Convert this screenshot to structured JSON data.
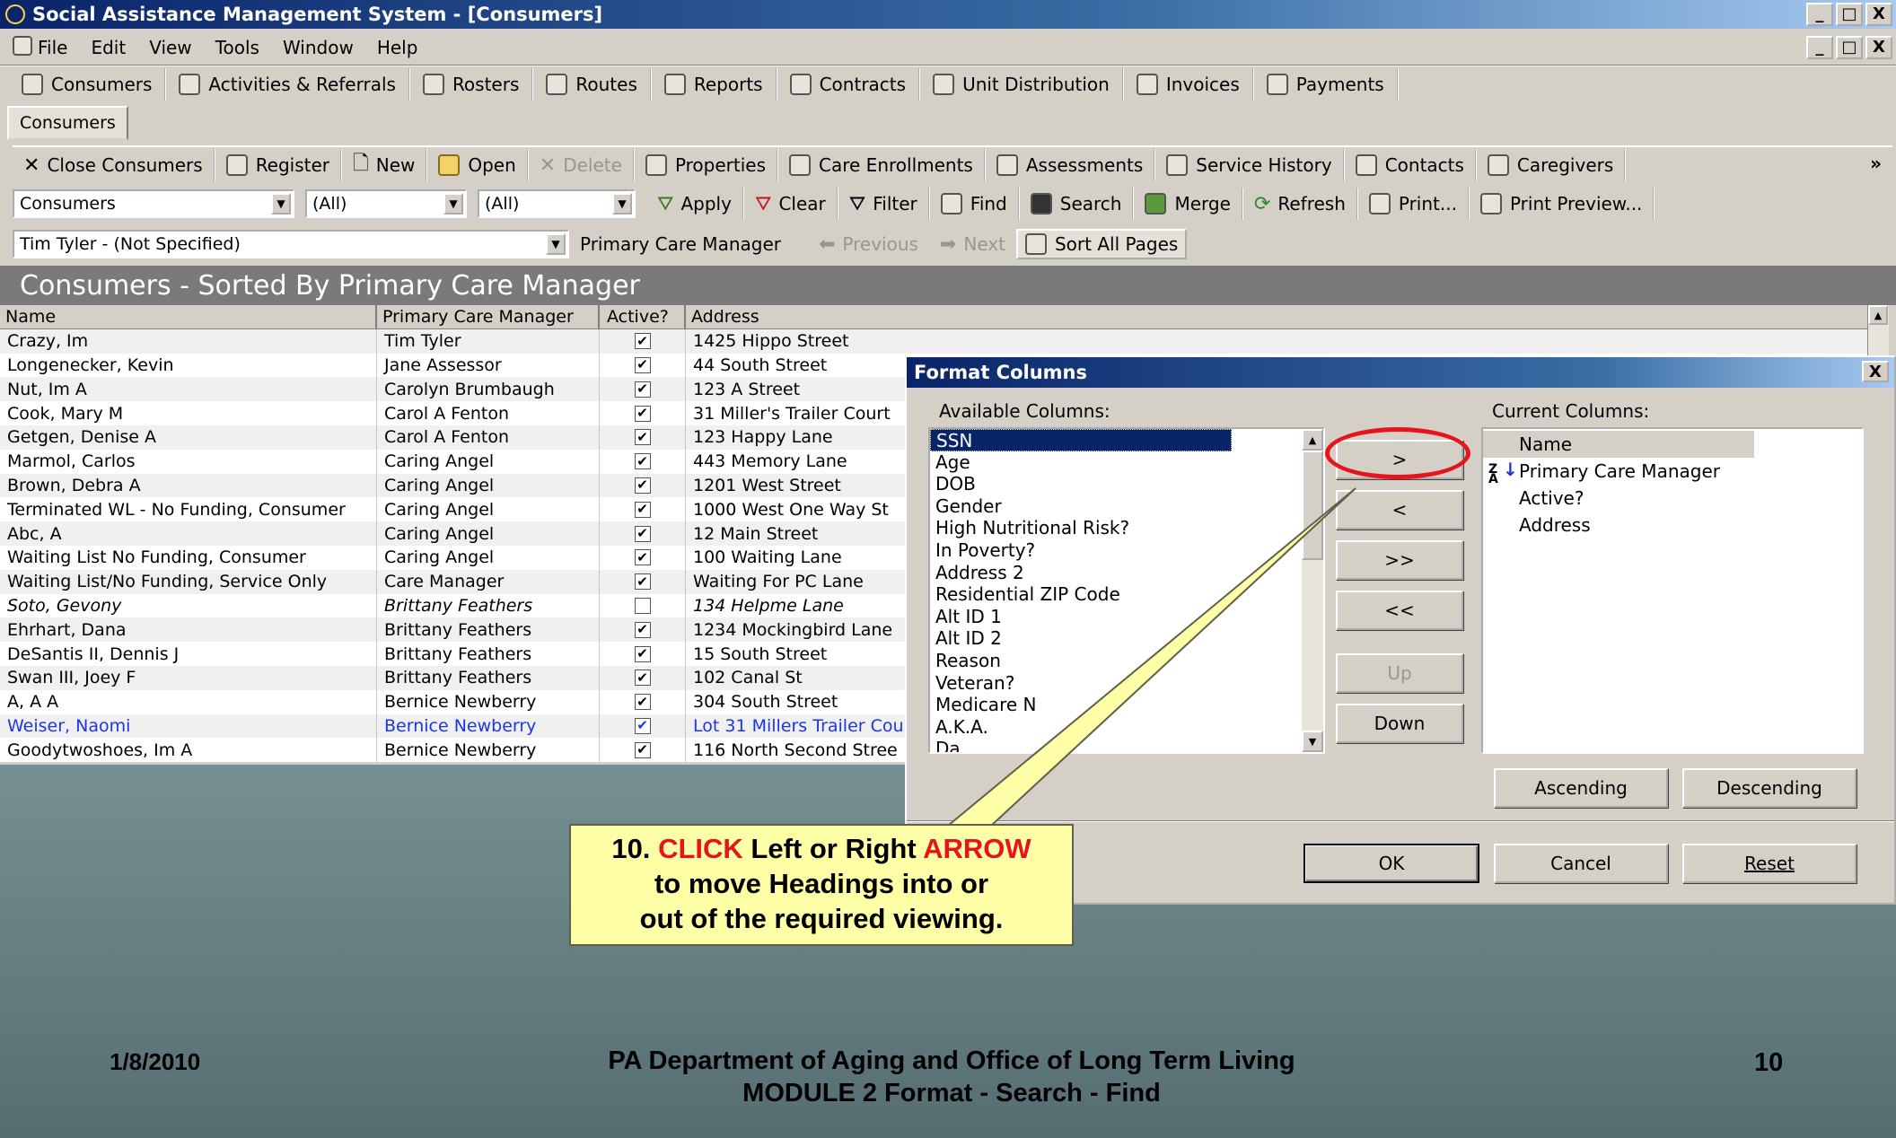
{
  "window": {
    "title": "Social Assistance Management System - [Consumers]",
    "controls": [
      "_",
      "□",
      "X"
    ]
  },
  "menu": [
    "File",
    "Edit",
    "View",
    "Tools",
    "Window",
    "Help"
  ],
  "modules": [
    "Consumers",
    "Activities & Referrals",
    "Rosters",
    "Routes",
    "Reports",
    "Contracts",
    "Unit Distribution",
    "Invoices",
    "Payments"
  ],
  "tab": "Consumers",
  "toolbar1": {
    "close": "Close Consumers",
    "register": "Register",
    "new": "New",
    "open": "Open",
    "delete": "Delete",
    "properties": "Properties",
    "care_enrollments": "Care Enrollments",
    "assessments": "Assessments",
    "service_history": "Service History",
    "contacts": "Contacts",
    "caregivers": "Caregivers",
    "more": "»"
  },
  "toolbar2": {
    "view_select": "Consumers",
    "filter1": "(All)",
    "filter2": "(All)",
    "apply": "Apply",
    "clear": "Clear",
    "filter": "Filter",
    "find": "Find",
    "search": "Search",
    "merge": "Merge",
    "refresh": "Refresh",
    "print": "Print...",
    "print_preview": "Print Preview..."
  },
  "toolbar3": {
    "record_select": "Tim Tyler - (Not Specified)",
    "sort_label": "Primary Care Manager",
    "previous": "Previous",
    "next": "Next",
    "sort_all": "Sort All Pages"
  },
  "grid": {
    "title": "Consumers - Sorted By Primary Care Manager",
    "columns": [
      "Name",
      "Primary Care Manager",
      "Active?",
      "Address"
    ],
    "rows": [
      {
        "name": "Crazy, Im",
        "manager": "Tim Tyler",
        "active": true,
        "address": "1425 Hippo Street"
      },
      {
        "name": "Longenecker, Kevin",
        "manager": "Jane Assessor",
        "active": true,
        "address": "44 South Street"
      },
      {
        "name": "Nut, Im A",
        "manager": "Carolyn Brumbaugh",
        "active": true,
        "address": "123 A Street"
      },
      {
        "name": "Cook, Mary M",
        "manager": "Carol A Fenton",
        "active": true,
        "address": "31 Miller's Trailer Court"
      },
      {
        "name": "Getgen, Denise A",
        "manager": "Carol A Fenton",
        "active": true,
        "address": "123 Happy Lane"
      },
      {
        "name": "Marmol, Carlos",
        "manager": "Caring Angel",
        "active": true,
        "address": "443 Memory Lane"
      },
      {
        "name": "Brown, Debra A",
        "manager": "Caring Angel",
        "active": true,
        "address": "1201 West Street"
      },
      {
        "name": "Terminated WL - No Funding, Consumer",
        "manager": "Caring Angel",
        "active": true,
        "address": "1000 West One Way St"
      },
      {
        "name": "Abc, A",
        "manager": "Caring Angel",
        "active": true,
        "address": "12 Main Street"
      },
      {
        "name": "Waiting List No Funding, Consumer",
        "manager": "Caring Angel",
        "active": true,
        "address": "100 Waiting Lane"
      },
      {
        "name": "Waiting List/No Funding, Service Only",
        "manager": "Care Manager",
        "active": true,
        "address": "Waiting For PC Lane"
      },
      {
        "name": "Soto, Gevony",
        "manager": "Brittany Feathers",
        "active": false,
        "address": "134 Helpme Lane",
        "style": "italic"
      },
      {
        "name": "Ehrhart, Dana",
        "manager": "Brittany Feathers",
        "active": true,
        "address": "1234 Mockingbird Lane"
      },
      {
        "name": "DeSantis II, Dennis J",
        "manager": "Brittany Feathers",
        "active": true,
        "address": "15 South Street"
      },
      {
        "name": "Swan III, Joey F",
        "manager": "Brittany Feathers",
        "active": true,
        "address": "102 Canal St"
      },
      {
        "name": "A, A A",
        "manager": "Bernice Newberry",
        "active": true,
        "address": "304 South Street"
      },
      {
        "name": "Weiser, Naomi",
        "manager": "Bernice Newberry",
        "active": true,
        "address": "Lot 31 Millers Trailer Cou",
        "style": "blue"
      },
      {
        "name": "Goodytwoshoes, Im A",
        "manager": "Bernice Newberry",
        "active": true,
        "address": "116 North Second Stree"
      }
    ]
  },
  "dialog": {
    "title": "Format Columns",
    "available_label": "Available Columns:",
    "current_label": "Current Columns:",
    "available": [
      "SSN",
      "Age",
      "DOB",
      "Gender",
      "High Nutritional Risk?",
      "In Poverty?",
      "Address 2",
      "Residential ZIP Code",
      "Alt ID 1",
      "Alt ID 2",
      "Reason",
      "Veteran?",
      "Medicare N",
      "A.K.A.",
      "Da"
    ],
    "current": [
      "Name",
      "Primary Care Manager",
      "Active?",
      "Address"
    ],
    "buttons": {
      "add": ">",
      "remove": "<",
      "add_all": ">>",
      "remove_all": "<<",
      "up": "Up",
      "down": "Down",
      "ascending": "Ascending",
      "descending": "Descending",
      "ok": "OK",
      "cancel": "Cancel",
      "reset": "Reset"
    }
  },
  "callout": {
    "num": "10.",
    "click": "CLICK",
    "mid": "Left or Right",
    "arrow": "ARROW",
    "line2": "to move Headings into or",
    "line3": "out of the required viewing."
  },
  "footer": {
    "date": "1/8/2010",
    "org": "PA Department of Aging and Office of Long Term Living",
    "module": "MODULE 2  Format - Search - Find",
    "page": "10"
  }
}
